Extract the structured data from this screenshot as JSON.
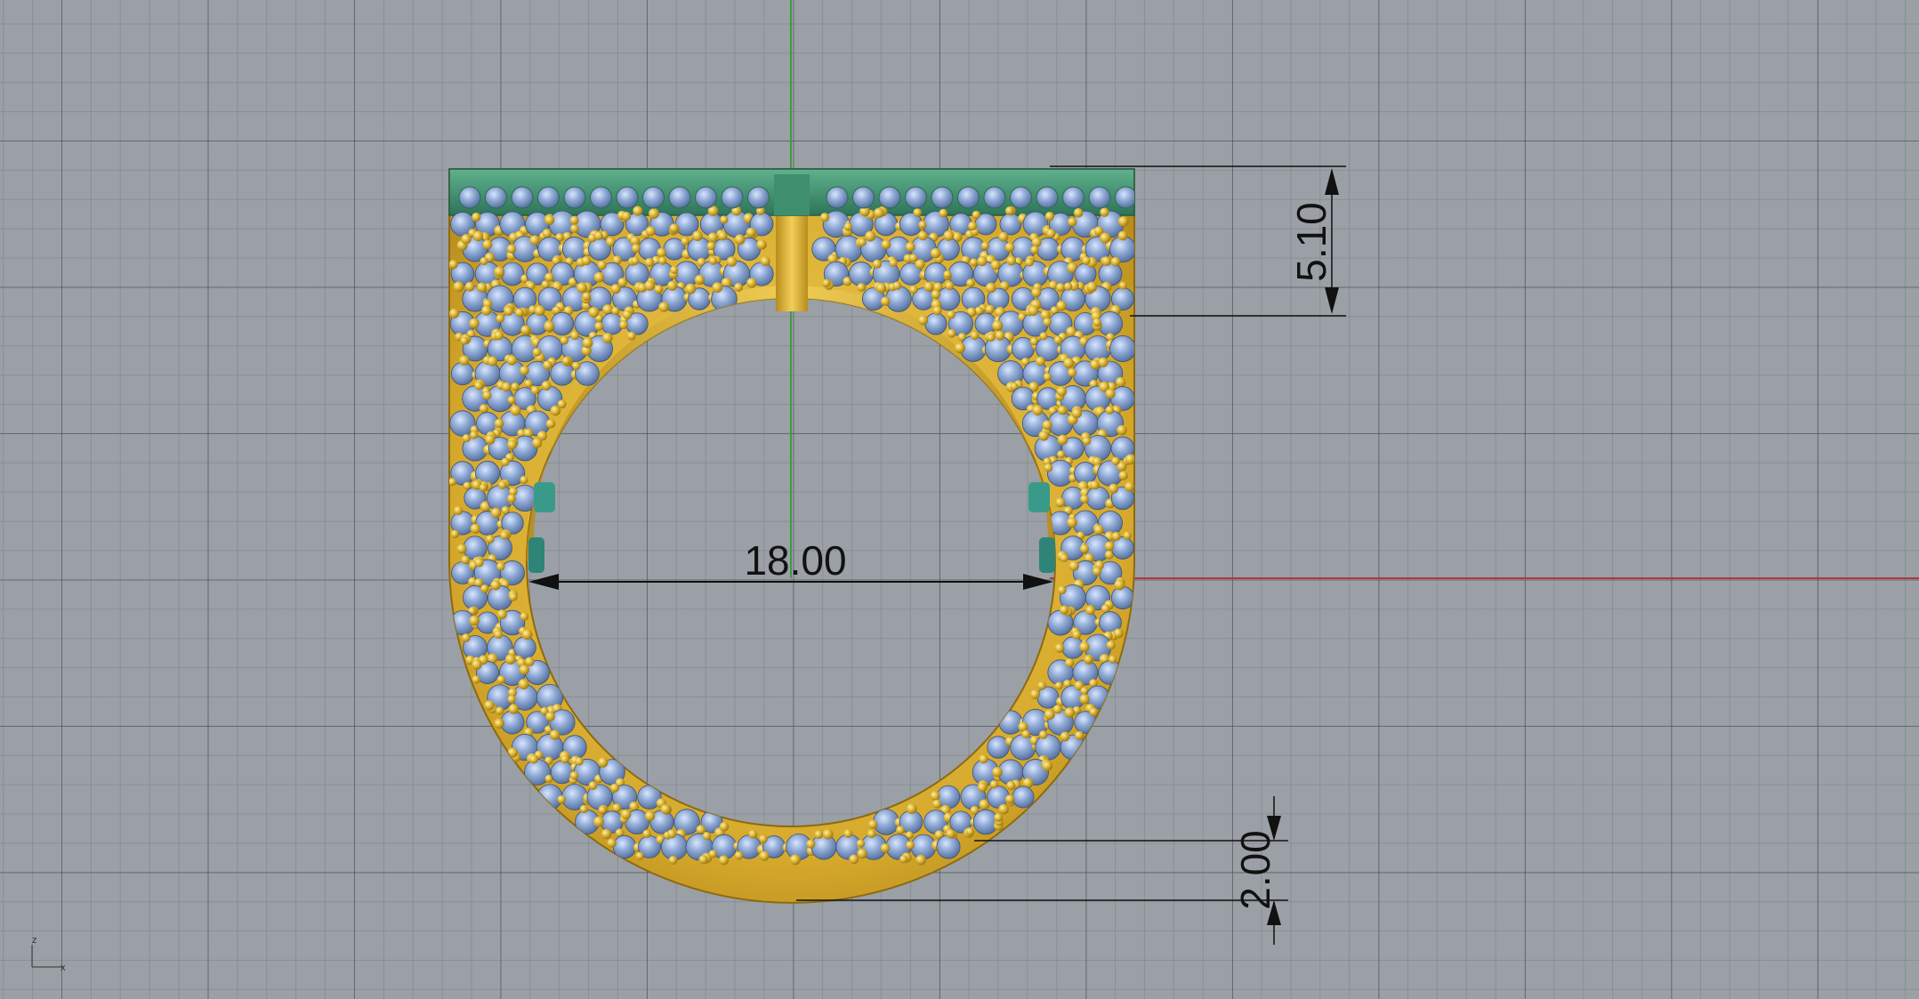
{
  "viewport": {
    "view": "Front",
    "background_color": "#9aa0a6",
    "axis_colors": {
      "x": "#b03a3a",
      "y": "#3f9a3f"
    }
  },
  "dimensions": {
    "top_band_height": "5.10",
    "inner_diameter": "18.00",
    "bottom_band_thickness": "2.00"
  },
  "axis_gizmo": {
    "x_label": "x",
    "z_label": "z"
  },
  "materials": {
    "metal": "#d9b23a",
    "gem": "#7f9cc6",
    "prong_top": "#3a8c6e"
  }
}
